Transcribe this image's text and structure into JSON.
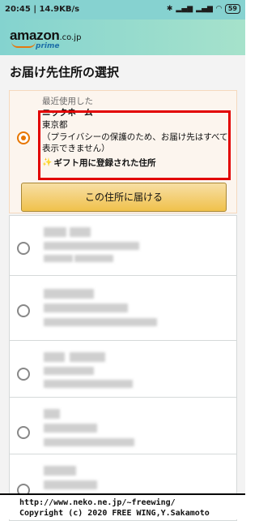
{
  "status": {
    "time": "20:45",
    "speed": "14.9KB/s",
    "bluetooth_icon": "bluetooth-icon",
    "signal_1": "signal-icon",
    "signal_2": "signal-icon",
    "wifi_icon": "wifi-icon",
    "battery": "59"
  },
  "header": {
    "brand": "amazon",
    "tld": ".co.jp",
    "prime": "prime"
  },
  "page": {
    "title": "お届け先住所の選択"
  },
  "selected_address": {
    "recent_label": "最近使用した",
    "nickname": "ニックネーム",
    "city": "東京都",
    "privacy_note": "（プライバシーの保護のため、お届け先はすべて表示できません）",
    "gift_label": "ギフト用に登録された住所",
    "deliver_button": "この住所に届ける"
  },
  "footer": {
    "line1": "http://www.neko.ne.jp/~freewing/",
    "line2": "Copyright (c) 2020 FREE WING,Y.Sakamoto"
  },
  "colors": {
    "header_bg": "#86d2d0",
    "accent_orange": "#e77600",
    "highlight_red": "#e20000",
    "button_yellow": "#f0c14b"
  }
}
